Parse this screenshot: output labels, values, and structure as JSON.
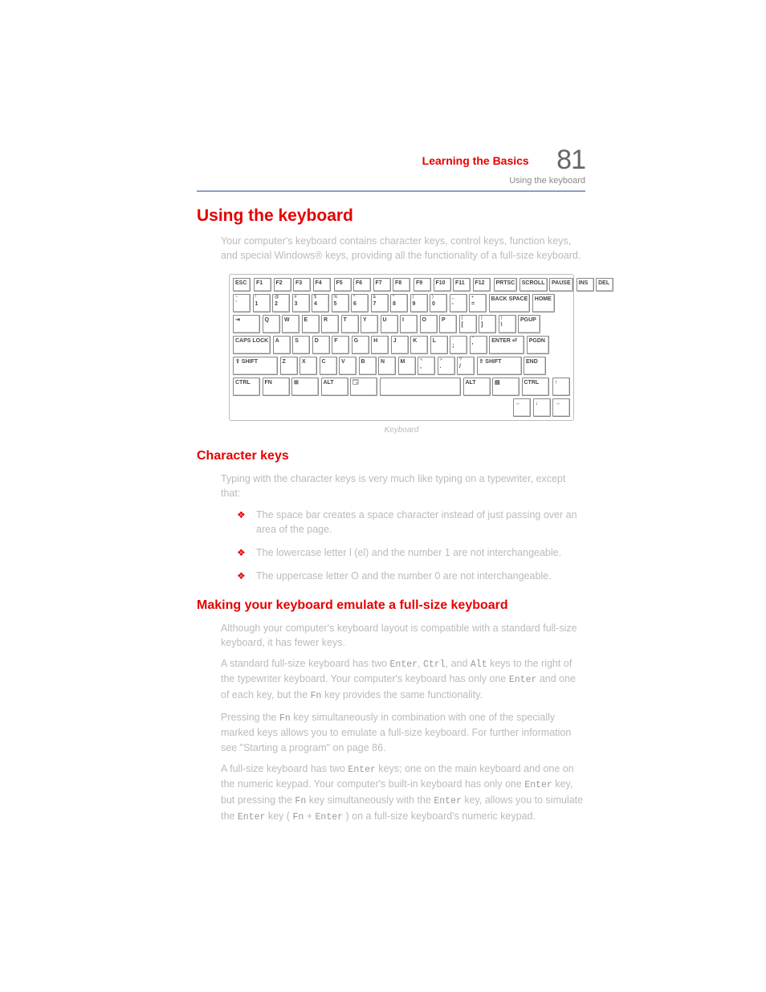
{
  "header": {
    "chapter": "Learning the Basics",
    "page_number": "81",
    "section_line": "Using the keyboard"
  },
  "h1": "Using the keyboard",
  "intro": "Your computer's keyboard contains character keys, control keys, function keys, and special Windows® keys, providing all the functionality of a full-size keyboard.",
  "keyboard_caption": "Keyboard",
  "kbd": {
    "fn_row_groups": [
      [
        "ESC"
      ],
      [
        "F1",
        "F2",
        "F3",
        "F4"
      ],
      [
        "F5",
        "F6",
        "F7",
        "F8"
      ],
      [
        "F9",
        "F10",
        "F11",
        "F12"
      ],
      [
        "PRTSC",
        "SCROLL",
        "PAUSE"
      ],
      [
        "INS",
        "DEL"
      ]
    ],
    "num_row": {
      "keys": [
        "~ `",
        "! 1",
        "@ 2",
        "# 3",
        "$ 4",
        "% 5",
        "^ 6",
        "& 7",
        "* 8",
        "( 9",
        ") 0",
        "_ -",
        "+ ="
      ],
      "back": "BACK SPACE",
      "side": "HOME"
    },
    "row_q": {
      "left": "⇥",
      "keys": [
        "Q",
        "W",
        "E",
        "R",
        "T",
        "Y",
        "U",
        "I",
        "O",
        "P",
        "{ [",
        "} ]",
        "| \\"
      ],
      "side": "PGUP"
    },
    "row_a": {
      "left": "CAPS LOCK",
      "keys": [
        "A",
        "S",
        "D",
        "F",
        "G",
        "H",
        "J",
        "K",
        "L",
        ": ;",
        "\" '"
      ],
      "enter": "ENTER ⏎",
      "side": "PGDN"
    },
    "row_z": {
      "left": "⇧ SHIFT",
      "keys": [
        "Z",
        "X",
        "C",
        "V",
        "B",
        "N",
        "M",
        "< ,",
        "> .",
        "? /"
      ],
      "right": "⇧ SHIFT",
      "side": "END"
    },
    "bottom": {
      "keys_left": [
        "CTRL",
        "FN",
        "⊞",
        "ALT",
        "🗔"
      ],
      "keys_right": [
        "ALT",
        "▤",
        "CTRL"
      ],
      "arrow_up": "↑"
    },
    "arrows": [
      "←",
      "↓",
      "→"
    ]
  },
  "h2_char": "Character keys",
  "char_intro": "Typing with the character keys is very much like typing on a typewriter, except that:",
  "char_bullets": [
    "The space bar creates a space character instead of just passing over an area of the page.",
    "The lowercase letter l (el) and the number 1 are not interchangeable.",
    "The uppercase letter O and the number 0 are not interchangeable."
  ],
  "h2_emulate": "Making your keyboard emulate a full-size keyboard",
  "emu_p1_a": "Although your computer's keyboard layout is compatible with a standard full-size keyboard, it has fewer keys.",
  "emu_p2_a": "A standard full-size keyboard has two ",
  "emu_p2_b": " keys to the right of the typewriter keyboard. Your computer's keyboard has only one ",
  "emu_p2_c": " key, but the ",
  "emu_p2_d": " key provides the same functionality.",
  "emu_p3_a": "Pressing the ",
  "emu_p3_b": " key simultaneously in combination with one of the specially marked keys allows you to emulate a full-size keyboard. For further information see \"Starting a program\" on page 86.",
  "emu_p4_a": "A full-size keyboard has two ",
  "emu_p4_b": " keys; one on the main keyboard and one on the numeric keypad. Your computer's built-in keyboard has only one ",
  "emu_p4_c": " key, but pressing the ",
  "emu_p4_d": " key simultaneously with the ",
  "emu_p4_e": " key, allows you to simulate the ",
  "emu_p4_f": " key (",
  "emu_p4_g": " + ",
  "emu_p4_h": ") on a full-size keyboard's numeric keypad.",
  "keys": {
    "enter": "Enter",
    "ctrl": "Ctrl",
    "alt": "Alt",
    "fn": "Fn"
  }
}
